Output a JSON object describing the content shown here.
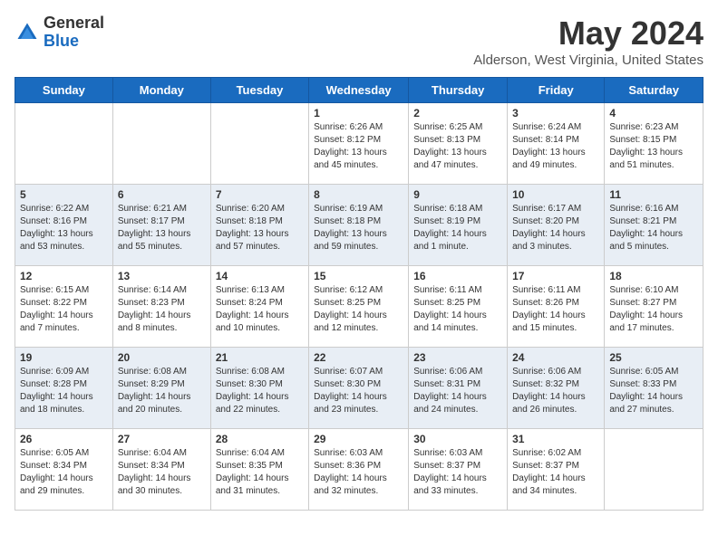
{
  "header": {
    "logo_general": "General",
    "logo_blue": "Blue",
    "month_title": "May 2024",
    "location": "Alderson, West Virginia, United States"
  },
  "weekdays": [
    "Sunday",
    "Monday",
    "Tuesday",
    "Wednesday",
    "Thursday",
    "Friday",
    "Saturday"
  ],
  "weeks": [
    [
      {
        "day": "",
        "info": ""
      },
      {
        "day": "",
        "info": ""
      },
      {
        "day": "",
        "info": ""
      },
      {
        "day": "1",
        "info": "Sunrise: 6:26 AM\nSunset: 8:12 PM\nDaylight: 13 hours and 45 minutes."
      },
      {
        "day": "2",
        "info": "Sunrise: 6:25 AM\nSunset: 8:13 PM\nDaylight: 13 hours and 47 minutes."
      },
      {
        "day": "3",
        "info": "Sunrise: 6:24 AM\nSunset: 8:14 PM\nDaylight: 13 hours and 49 minutes."
      },
      {
        "day": "4",
        "info": "Sunrise: 6:23 AM\nSunset: 8:15 PM\nDaylight: 13 hours and 51 minutes."
      }
    ],
    [
      {
        "day": "5",
        "info": "Sunrise: 6:22 AM\nSunset: 8:16 PM\nDaylight: 13 hours and 53 minutes."
      },
      {
        "day": "6",
        "info": "Sunrise: 6:21 AM\nSunset: 8:17 PM\nDaylight: 13 hours and 55 minutes."
      },
      {
        "day": "7",
        "info": "Sunrise: 6:20 AM\nSunset: 8:18 PM\nDaylight: 13 hours and 57 minutes."
      },
      {
        "day": "8",
        "info": "Sunrise: 6:19 AM\nSunset: 8:18 PM\nDaylight: 13 hours and 59 minutes."
      },
      {
        "day": "9",
        "info": "Sunrise: 6:18 AM\nSunset: 8:19 PM\nDaylight: 14 hours and 1 minute."
      },
      {
        "day": "10",
        "info": "Sunrise: 6:17 AM\nSunset: 8:20 PM\nDaylight: 14 hours and 3 minutes."
      },
      {
        "day": "11",
        "info": "Sunrise: 6:16 AM\nSunset: 8:21 PM\nDaylight: 14 hours and 5 minutes."
      }
    ],
    [
      {
        "day": "12",
        "info": "Sunrise: 6:15 AM\nSunset: 8:22 PM\nDaylight: 14 hours and 7 minutes."
      },
      {
        "day": "13",
        "info": "Sunrise: 6:14 AM\nSunset: 8:23 PM\nDaylight: 14 hours and 8 minutes."
      },
      {
        "day": "14",
        "info": "Sunrise: 6:13 AM\nSunset: 8:24 PM\nDaylight: 14 hours and 10 minutes."
      },
      {
        "day": "15",
        "info": "Sunrise: 6:12 AM\nSunset: 8:25 PM\nDaylight: 14 hours and 12 minutes."
      },
      {
        "day": "16",
        "info": "Sunrise: 6:11 AM\nSunset: 8:25 PM\nDaylight: 14 hours and 14 minutes."
      },
      {
        "day": "17",
        "info": "Sunrise: 6:11 AM\nSunset: 8:26 PM\nDaylight: 14 hours and 15 minutes."
      },
      {
        "day": "18",
        "info": "Sunrise: 6:10 AM\nSunset: 8:27 PM\nDaylight: 14 hours and 17 minutes."
      }
    ],
    [
      {
        "day": "19",
        "info": "Sunrise: 6:09 AM\nSunset: 8:28 PM\nDaylight: 14 hours and 18 minutes."
      },
      {
        "day": "20",
        "info": "Sunrise: 6:08 AM\nSunset: 8:29 PM\nDaylight: 14 hours and 20 minutes."
      },
      {
        "day": "21",
        "info": "Sunrise: 6:08 AM\nSunset: 8:30 PM\nDaylight: 14 hours and 22 minutes."
      },
      {
        "day": "22",
        "info": "Sunrise: 6:07 AM\nSunset: 8:30 PM\nDaylight: 14 hours and 23 minutes."
      },
      {
        "day": "23",
        "info": "Sunrise: 6:06 AM\nSunset: 8:31 PM\nDaylight: 14 hours and 24 minutes."
      },
      {
        "day": "24",
        "info": "Sunrise: 6:06 AM\nSunset: 8:32 PM\nDaylight: 14 hours and 26 minutes."
      },
      {
        "day": "25",
        "info": "Sunrise: 6:05 AM\nSunset: 8:33 PM\nDaylight: 14 hours and 27 minutes."
      }
    ],
    [
      {
        "day": "26",
        "info": "Sunrise: 6:05 AM\nSunset: 8:34 PM\nDaylight: 14 hours and 29 minutes."
      },
      {
        "day": "27",
        "info": "Sunrise: 6:04 AM\nSunset: 8:34 PM\nDaylight: 14 hours and 30 minutes."
      },
      {
        "day": "28",
        "info": "Sunrise: 6:04 AM\nSunset: 8:35 PM\nDaylight: 14 hours and 31 minutes."
      },
      {
        "day": "29",
        "info": "Sunrise: 6:03 AM\nSunset: 8:36 PM\nDaylight: 14 hours and 32 minutes."
      },
      {
        "day": "30",
        "info": "Sunrise: 6:03 AM\nSunset: 8:37 PM\nDaylight: 14 hours and 33 minutes."
      },
      {
        "day": "31",
        "info": "Sunrise: 6:02 AM\nSunset: 8:37 PM\nDaylight: 14 hours and 34 minutes."
      },
      {
        "day": "",
        "info": ""
      }
    ]
  ]
}
